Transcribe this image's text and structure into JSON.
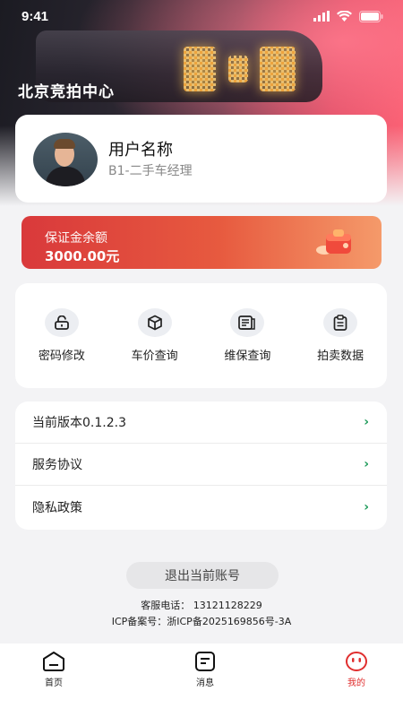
{
  "status_bar": {
    "time": "9:41"
  },
  "header": {
    "org_name": "北京竞拍中心"
  },
  "profile": {
    "name": "用户名称",
    "role": "B1-二手车经理"
  },
  "deposit": {
    "label": "保证金余额",
    "amount": "3000.00元"
  },
  "quick_actions": [
    {
      "label": "密码修改",
      "icon": "lock-icon"
    },
    {
      "label": "车价查询",
      "icon": "box-icon"
    },
    {
      "label": "维保查询",
      "icon": "document-icon"
    },
    {
      "label": "拍卖数据",
      "icon": "clipboard-icon"
    }
  ],
  "menu": [
    {
      "label": "当前版本0.1.2.3"
    },
    {
      "label": "服务协议"
    },
    {
      "label": "隐私政策"
    }
  ],
  "logout_label": "退出当前账号",
  "footer": {
    "phone": "客服电话： 13121128229",
    "icp": "ICP备案号：浙ICP备2025169856号-3A"
  },
  "tabbar": [
    {
      "label": "首页",
      "icon": "home-icon",
      "active": false
    },
    {
      "label": "消息",
      "icon": "message-icon",
      "active": false
    },
    {
      "label": "我的",
      "icon": "profile-face-icon",
      "active": true
    }
  ],
  "colors": {
    "accent": "#e02e2e",
    "chevron": "#1e9b5a",
    "deposit_start": "#d9393b",
    "deposit_end": "#f59a6a"
  }
}
